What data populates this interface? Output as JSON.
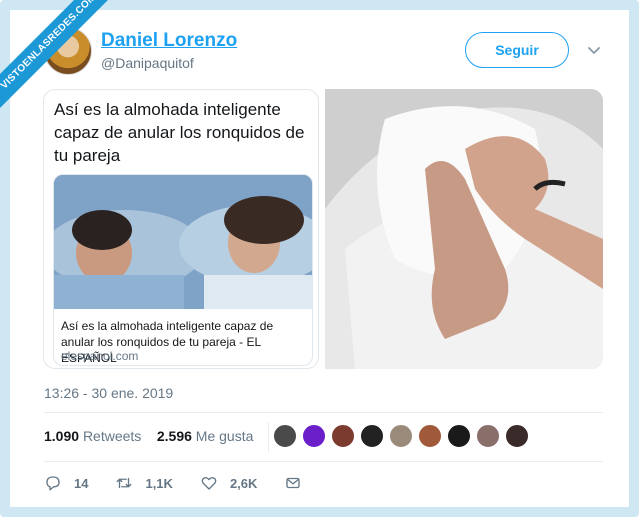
{
  "watermark": {
    "text": "VISTOENLASREDES.COM"
  },
  "author": {
    "name": "Daniel Lorenzo",
    "handle": "@Danipaquitof"
  },
  "follow_button": {
    "label": "Seguir"
  },
  "tweet": {
    "headline": "Así es la almohada inteligente capaz de anular los ronquidos de tu pareja",
    "link_card": {
      "title": "Así es la almohada inteligente capaz de anular los ronquidos de tu pareja - EL ESPAÑOL",
      "domain": "elespanol.com"
    },
    "timestamp": "13:26 - 30 ene. 2019"
  },
  "stats": {
    "retweets_count": "1.090",
    "retweets_label": "Retweets",
    "likes_count": "2.596",
    "likes_label": "Me gusta"
  },
  "likers": [
    "#4a4a4a",
    "#6a1fc8",
    "#7b3b2e",
    "#222222",
    "#9a8a7a",
    "#a05a3a",
    "#1a1a1a",
    "#8a6e6a",
    "#3a2a2a"
  ],
  "actions": {
    "reply_count": "14",
    "retweet_count": "1,1K",
    "like_count": "2,6K"
  },
  "colors": {
    "accent": "#1da1f2",
    "frame": "#cfe6f3",
    "watermark": "#1c98d7"
  }
}
